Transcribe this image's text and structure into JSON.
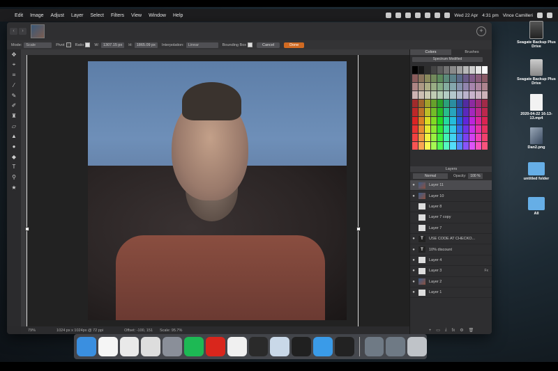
{
  "menubar": {
    "apple": "",
    "items": [
      "Edit",
      "Image",
      "Adjust",
      "Layer",
      "Select",
      "Filters",
      "View",
      "Window",
      "Help"
    ],
    "date": "Wed 22 Apr",
    "time": "4:31 pm",
    "user": "Vince Camilleri"
  },
  "options": {
    "mode_label": "Mode:",
    "mode_value": "Scale",
    "pivot_label": "Pivot",
    "ratio_label": "Ratio",
    "w_label": "W:",
    "w_value": "1307.15 px",
    "h_label": "H:",
    "h_value": "1865.09 px",
    "interp_label": "Interpolation:",
    "interp_value": "Linear",
    "bbox_label": "Bounding Box",
    "cancel": "Cancel",
    "done": "Done"
  },
  "status": {
    "zoom": "79%",
    "size": "1024 px x 1024px @ 72 ppi",
    "offset": "Offset: -100, 151",
    "scale": "Scale: 95.7%"
  },
  "panel": {
    "tab_colors": "Colors",
    "tab_brushes": "Brushes",
    "color_set": "Spectrum Modified",
    "layers_title": "Layers",
    "blend_mode": "Normal",
    "opacity_label": "Opacity:",
    "opacity_value": "100 %",
    "layers": [
      {
        "name": "Layer 11",
        "thumb": "img",
        "visible": "●",
        "fx": ""
      },
      {
        "name": "Layer 10",
        "thumb": "img",
        "visible": "●",
        "fx": ""
      },
      {
        "name": "Layer 8",
        "thumb": "",
        "visible": "",
        "fx": ""
      },
      {
        "name": "Layer 7 copy",
        "thumb": "",
        "visible": "",
        "fx": ""
      },
      {
        "name": "Layer 7",
        "thumb": "",
        "visible": "",
        "fx": ""
      },
      {
        "name": "USE CODE AT CHECKO...",
        "thumb": "T",
        "visible": "●",
        "fx": ""
      },
      {
        "name": "10% discount",
        "thumb": "T",
        "visible": "●",
        "fx": ""
      },
      {
        "name": "Layer 4",
        "thumb": "",
        "visible": "●",
        "fx": ""
      },
      {
        "name": "Layer 3",
        "thumb": "",
        "visible": "●",
        "fx": "Fx"
      },
      {
        "name": "Layer 2",
        "thumb": "img",
        "visible": "●",
        "fx": ""
      },
      {
        "name": "Layer 1",
        "thumb": "",
        "visible": "●",
        "fx": ""
      }
    ]
  },
  "desktop": {
    "items": [
      {
        "label": "Seagate Backup Plus Drive",
        "type": "drive-dark"
      },
      {
        "label": "Seagate Backup Plus Drive",
        "type": "drive"
      },
      {
        "label": "2020-04-22 16-13-13.mp4",
        "type": "file"
      },
      {
        "label": "Dan2.png",
        "type": "file-img"
      },
      {
        "label": "untitled folder",
        "type": "folder"
      },
      {
        "label": "All",
        "type": "folder"
      }
    ]
  },
  "dock": {
    "apps": [
      {
        "name": "finder-icon",
        "color": "#3a8fe0",
        "glyph": ""
      },
      {
        "name": "photos-icon",
        "color": "#f5f5f5",
        "glyph": ""
      },
      {
        "name": "chrome-icon",
        "color": "#e9e9e9",
        "glyph": ""
      },
      {
        "name": "disk-utility-icon",
        "color": "#dddddd",
        "glyph": ""
      },
      {
        "name": "launchpad-icon",
        "color": "#8a8f99",
        "glyph": ""
      },
      {
        "name": "spotify-icon",
        "color": "#1db954",
        "glyph": ""
      },
      {
        "name": "acrobat-icon",
        "color": "#d9261c",
        "glyph": ""
      },
      {
        "name": "itunes-icon",
        "color": "#f0f0f0",
        "glyph": ""
      },
      {
        "name": "affinity-photo-icon",
        "color": "#2a2a2a",
        "glyph": ""
      },
      {
        "name": "preview-icon",
        "color": "#c9d8e8",
        "glyph": ""
      },
      {
        "name": "final-cut-icon",
        "color": "#202020",
        "glyph": ""
      },
      {
        "name": "safari-icon",
        "color": "#3a9be8",
        "glyph": ""
      },
      {
        "name": "obs-icon",
        "color": "#222222",
        "glyph": ""
      }
    ]
  }
}
